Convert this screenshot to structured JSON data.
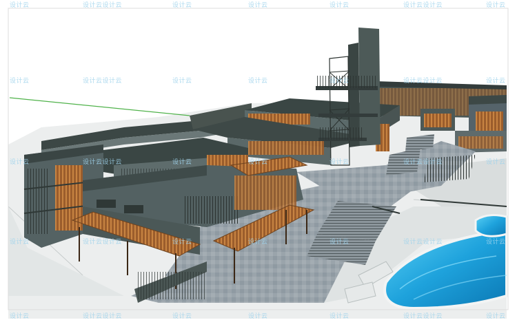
{
  "scene": {
    "kind": "3D architectural model render",
    "colors": {
      "background": "#ffffff",
      "roof": "#3a4644",
      "wall": "#596b6b",
      "timber": "#b0703a",
      "water": "#2aa8de",
      "paving": "#9aa4ab",
      "terrain": "#e9ecec",
      "axis_green": "#4fb24a"
    }
  },
  "watermark": {
    "single": "设计云",
    "double": "设计云设计云"
  }
}
